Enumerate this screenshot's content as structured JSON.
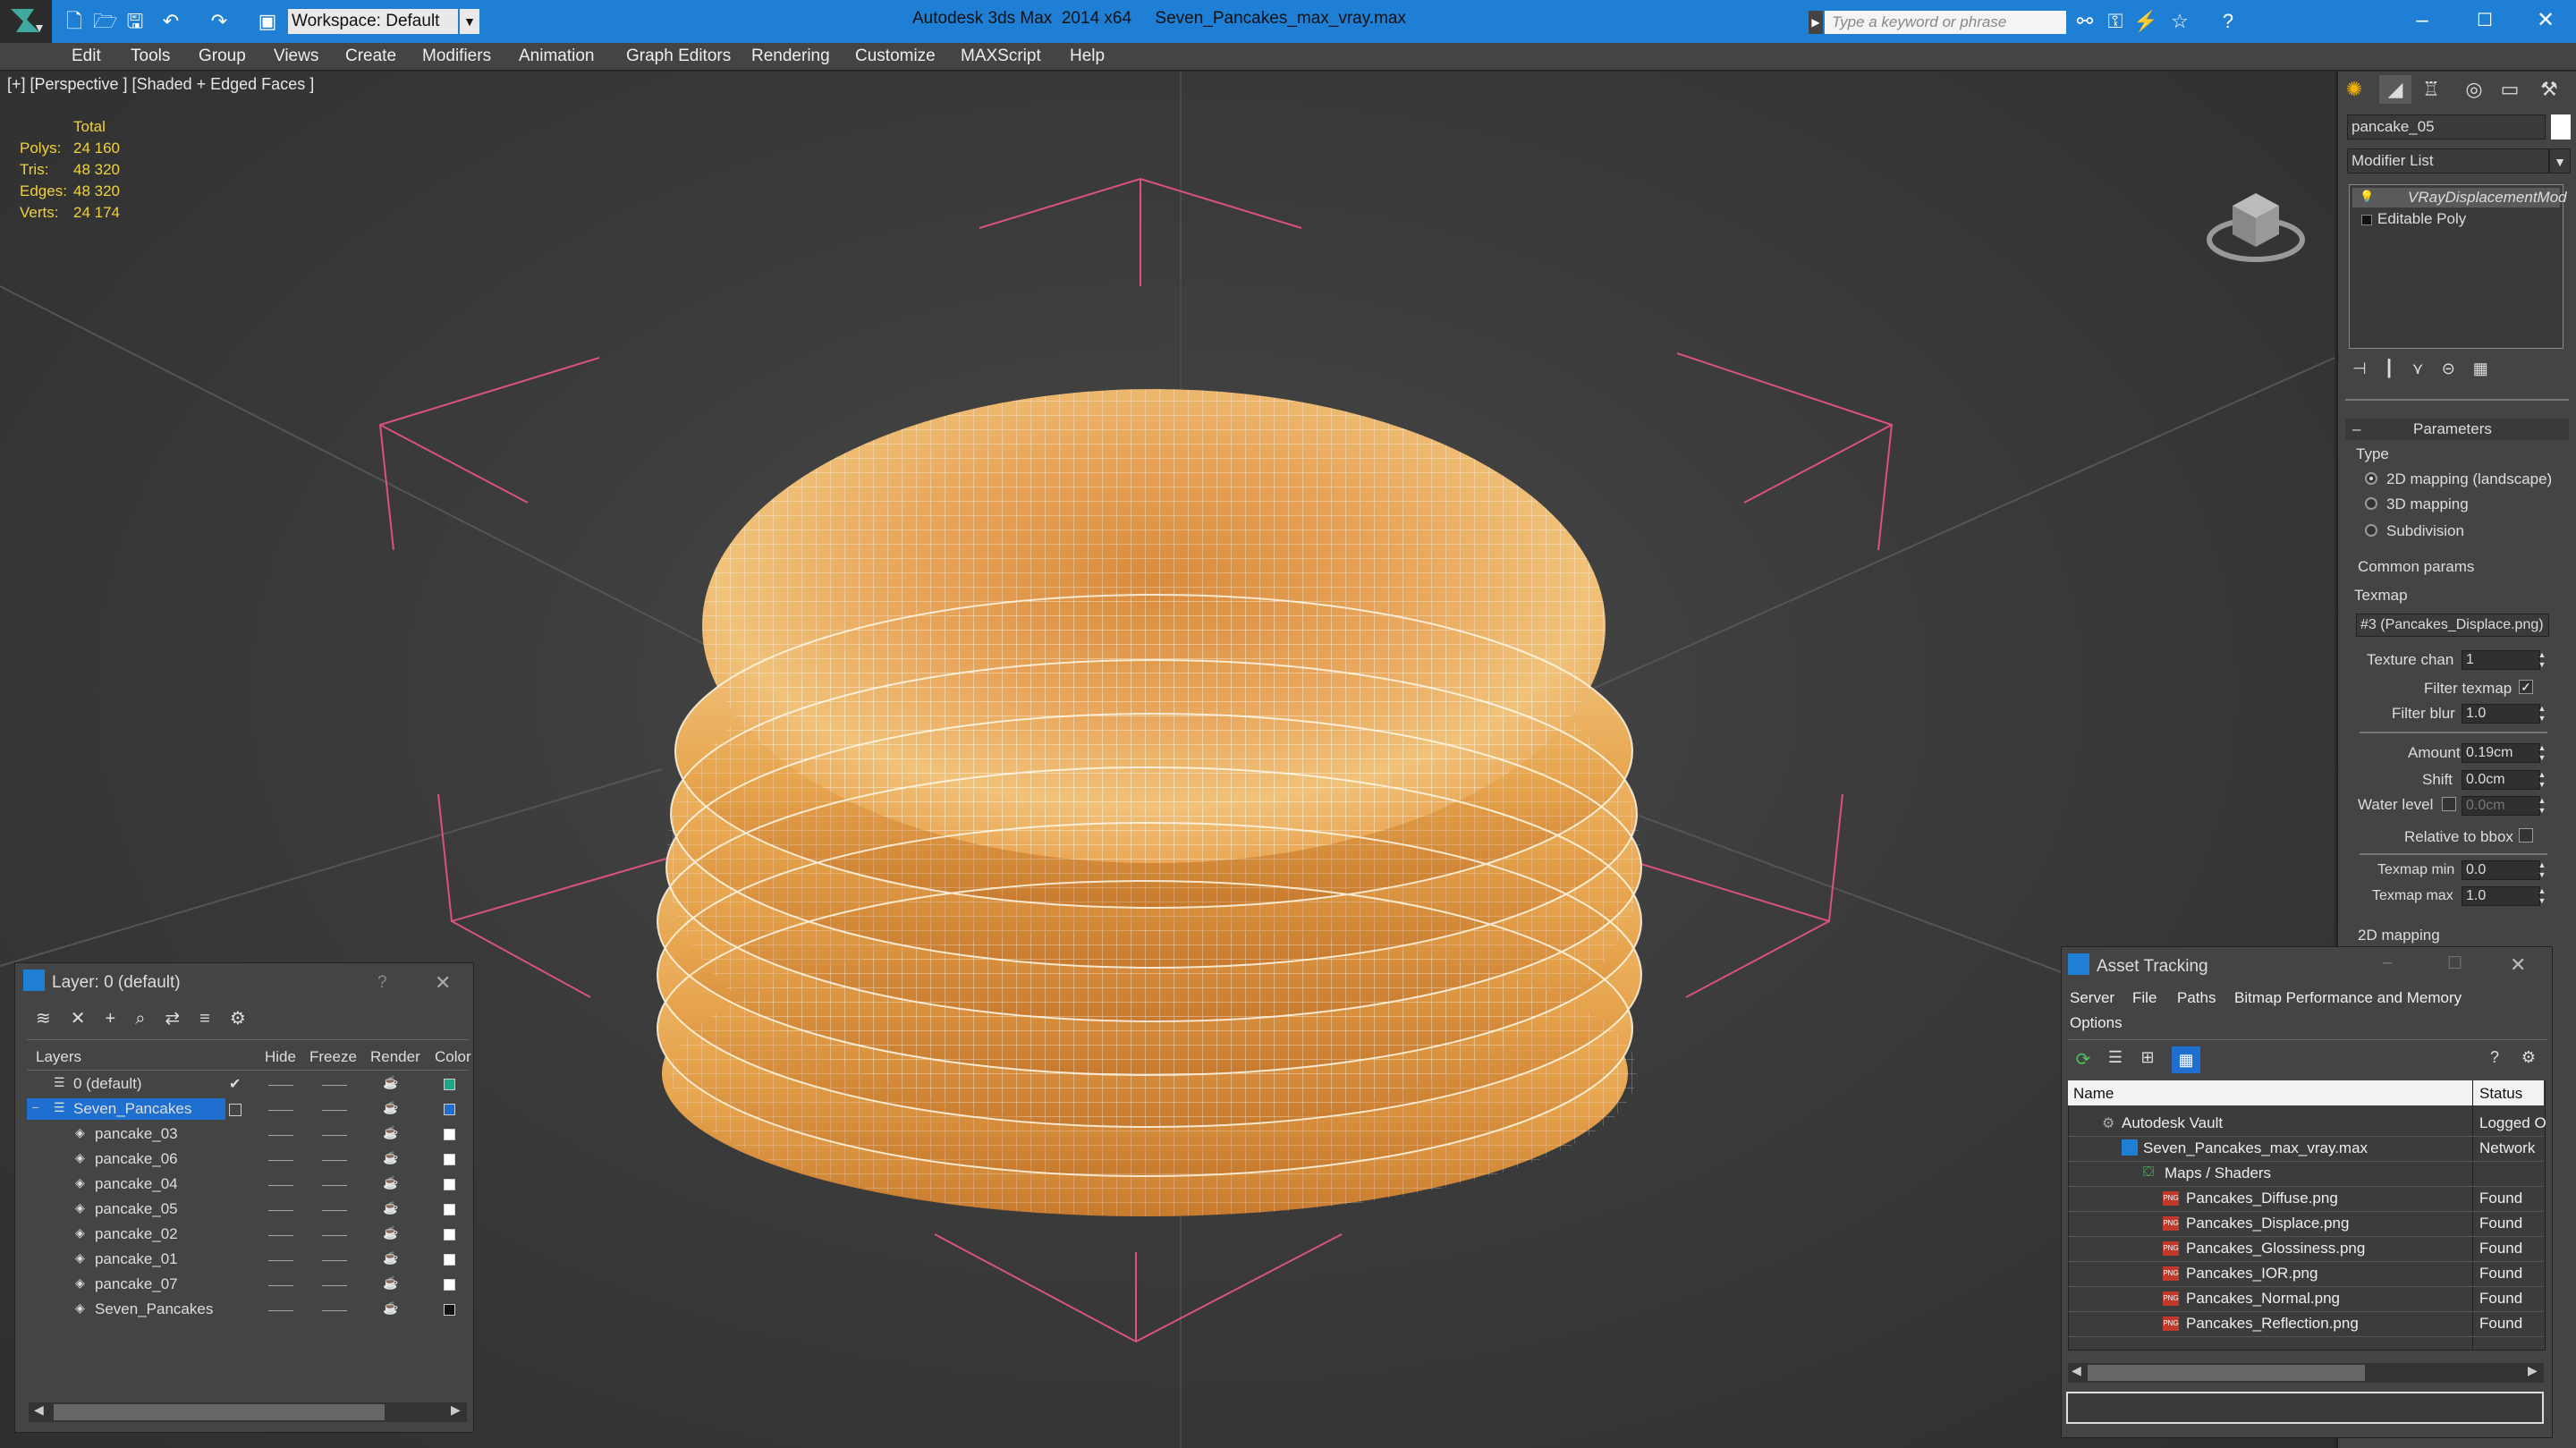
{
  "app": {
    "title": "Autodesk 3ds Max  2014 x64     Seven_Pancakes_max_vray.max",
    "workspace": "Workspace: Default",
    "search_placeholder": "Type a keyword or phrase"
  },
  "menu": [
    "Edit",
    "Tools",
    "Group",
    "Views",
    "Create",
    "Modifiers",
    "Animation",
    "Graph Editors",
    "Rendering",
    "Customize",
    "MAXScript",
    "Help"
  ],
  "viewport": {
    "label": "[+] [Perspective ] [Shaded + Edged Faces ]",
    "stats_header": "Total",
    "stats": [
      {
        "label": "Polys:",
        "value": "24 160"
      },
      {
        "label": "Tris:",
        "value": "48 320"
      },
      {
        "label": "Edges:",
        "value": "48 320"
      },
      {
        "label": "Verts:",
        "value": "24 174"
      }
    ]
  },
  "command_panel": {
    "object_name": "pancake_05",
    "modifier_list": "Modifier List",
    "stack": [
      "VRayDisplacementMod",
      "Editable Poly"
    ],
    "rollout_title": "Parameters",
    "type_label": "Type",
    "type_options": [
      "2D mapping (landscape)",
      "3D mapping",
      "Subdivision"
    ],
    "common_params": "Common params",
    "texmap_label": "Texmap",
    "texmap_value": "#3 (Pancakes_Displace.png)",
    "texture_chan_label": "Texture chan",
    "texture_chan_value": "1",
    "filter_texmap_label": "Filter texmap",
    "filter_blur_label": "Filter blur",
    "filter_blur_value": "1.0",
    "amount_label": "Amount",
    "amount_value": "0.19cm",
    "shift_label": "Shift",
    "shift_value": "0.0cm",
    "water_level_label": "Water level",
    "water_level_value": "0.0cm",
    "relative_bbox_label": "Relative to bbox",
    "texmap_min_label": "Texmap min",
    "texmap_min_value": "0.0",
    "texmap_max_label": "Texmap max",
    "texmap_max_value": "1.0",
    "mapping_2d_label": "2D mapping"
  },
  "layer_window": {
    "title": "Layer: 0 (default)",
    "help": "?",
    "columns": [
      "Layers",
      "Hide",
      "Freeze",
      "Render",
      "Color"
    ],
    "rows": [
      {
        "name": "0 (default)",
        "color": "#1aa889"
      },
      {
        "name": "Seven_Pancakes",
        "color": "#1f6fd1"
      },
      {
        "name": "pancake_03",
        "color": "#ffffff"
      },
      {
        "name": "pancake_06",
        "color": "#ffffff"
      },
      {
        "name": "pancake_04",
        "color": "#ffffff"
      },
      {
        "name": "pancake_05",
        "color": "#ffffff"
      },
      {
        "name": "pancake_02",
        "color": "#ffffff"
      },
      {
        "name": "pancake_01",
        "color": "#ffffff"
      },
      {
        "name": "pancake_07",
        "color": "#ffffff"
      },
      {
        "name": "Seven_Pancakes",
        "color": "#111111"
      }
    ]
  },
  "asset_window": {
    "title": "Asset Tracking",
    "menu": [
      "Server",
      "File",
      "Paths",
      "Bitmap Performance and Memory",
      "Options"
    ],
    "columns": [
      "Name",
      "Status"
    ],
    "rows": [
      {
        "name": "Autodesk Vault",
        "status": "Logged O"
      },
      {
        "name": "Seven_Pancakes_max_vray.max",
        "status": "Network"
      },
      {
        "name": "Maps / Shaders",
        "status": ""
      },
      {
        "name": "Pancakes_Diffuse.png",
        "status": "Found"
      },
      {
        "name": "Pancakes_Displace.png",
        "status": "Found"
      },
      {
        "name": "Pancakes_Glossiness.png",
        "status": "Found"
      },
      {
        "name": "Pancakes_IOR.png",
        "status": "Found"
      },
      {
        "name": "Pancakes_Normal.png",
        "status": "Found"
      },
      {
        "name": "Pancakes_Reflection.png",
        "status": "Found"
      }
    ]
  },
  "colors": {
    "titlebar": "#1e7fd4",
    "selection": "#1f6fd1",
    "stats": "#f0d23a",
    "bbox_lines": "#d9537a"
  }
}
